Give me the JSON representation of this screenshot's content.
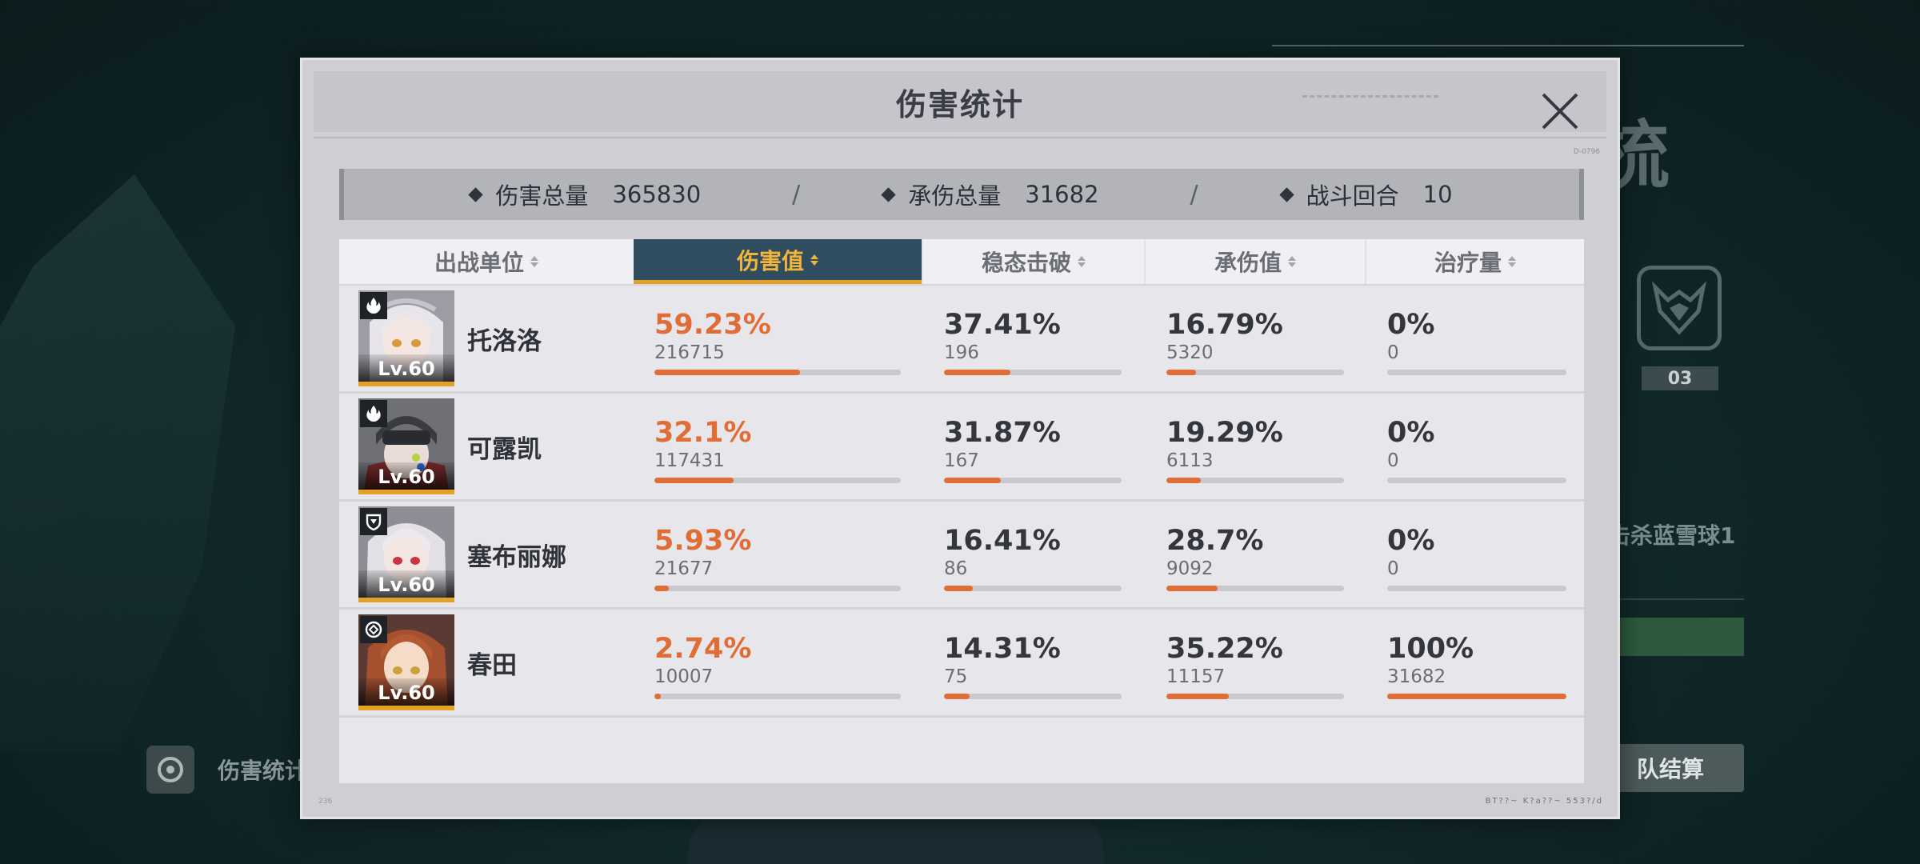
{
  "background": {
    "title_char": "梳",
    "emblem_label": "03",
    "kill_text": "击杀蓝雪球1",
    "settle_button": "队结算",
    "stat_label": "伤害统计"
  },
  "dialog": {
    "title": "伤害统计",
    "serial_small": "D-0796",
    "footer_left": "236",
    "footer_right": "BT??~ K?a??~ 553?/d"
  },
  "summary": {
    "total_damage_label": "伤害总量",
    "total_damage_value": "365830",
    "total_taken_label": "承伤总量",
    "total_taken_value": "31682",
    "rounds_label": "战斗回合",
    "rounds_value": "10",
    "separator": "/"
  },
  "columns": {
    "unit": "出战单位",
    "damage": "伤害值",
    "break": "稳态击破",
    "taken": "承伤值",
    "heal": "治疗量",
    "active_sort": "damage"
  },
  "units": [
    {
      "name": "托洛洛",
      "level": "Lv.60",
      "class_icon": "fire-class-icon",
      "damage_pct": "59.23%",
      "damage_raw": "216715",
      "damage_ratio": 0.5923,
      "break_pct": "37.41%",
      "break_raw": "196",
      "break_ratio": 0.3741,
      "taken_pct": "16.79%",
      "taken_raw": "5320",
      "taken_ratio": 0.1679,
      "heal_pct": "0%",
      "heal_raw": "0",
      "heal_ratio": 0
    },
    {
      "name": "可露凯",
      "level": "Lv.60",
      "class_icon": "fire-class-icon",
      "damage_pct": "32.1%",
      "damage_raw": "117431",
      "damage_ratio": 0.321,
      "break_pct": "31.87%",
      "break_raw": "167",
      "break_ratio": 0.3187,
      "taken_pct": "19.29%",
      "taken_raw": "6113",
      "taken_ratio": 0.1929,
      "heal_pct": "0%",
      "heal_raw": "0",
      "heal_ratio": 0
    },
    {
      "name": "塞布丽娜",
      "level": "Lv.60",
      "class_icon": "shield-class-icon",
      "damage_pct": "5.93%",
      "damage_raw": "21677",
      "damage_ratio": 0.0593,
      "break_pct": "16.41%",
      "break_raw": "86",
      "break_ratio": 0.1641,
      "taken_pct": "28.7%",
      "taken_raw": "9092",
      "taken_ratio": 0.287,
      "heal_pct": "0%",
      "heal_raw": "0",
      "heal_ratio": 0
    },
    {
      "name": "春田",
      "level": "Lv.60",
      "class_icon": "support-class-icon",
      "damage_pct": "2.74%",
      "damage_raw": "10007",
      "damage_ratio": 0.0274,
      "break_pct": "14.31%",
      "break_raw": "75",
      "break_ratio": 0.1431,
      "taken_pct": "35.22%",
      "taken_raw": "11157",
      "taken_ratio": 0.3522,
      "heal_pct": "100%",
      "heal_raw": "31682",
      "heal_ratio": 1.0
    }
  ],
  "colors": {
    "accent_orange": "#e06d35",
    "accent_gold": "#e2a227",
    "header_active_bg": "#2f4d5f"
  }
}
